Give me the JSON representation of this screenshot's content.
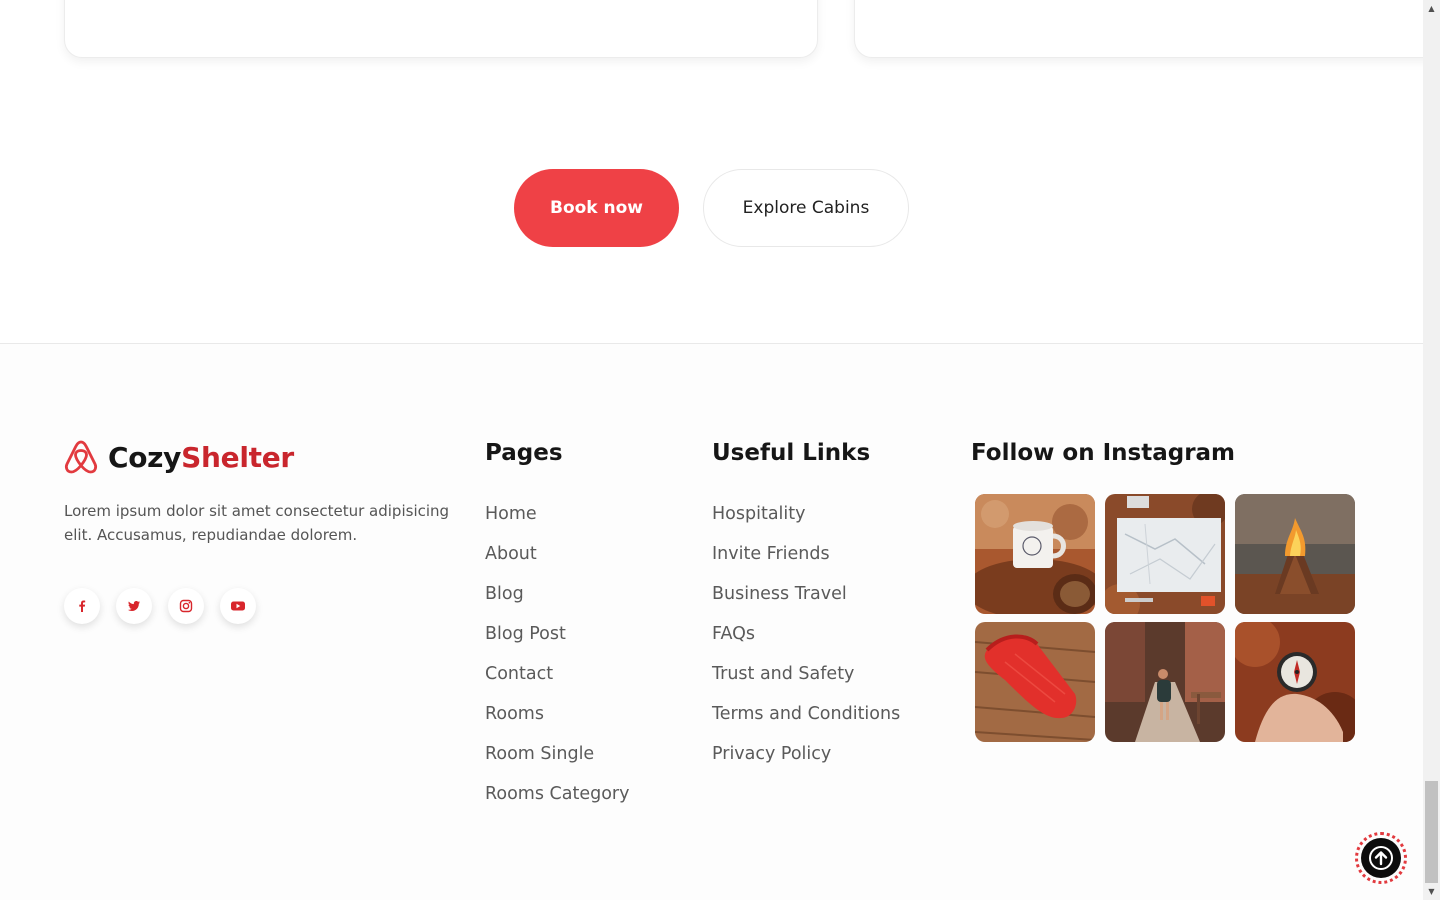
{
  "cta": {
    "book_label": "Book now",
    "explore_label": "Explore Cabins"
  },
  "brand": {
    "name_part1": "Cozy",
    "name_part2": "Shelter",
    "description": "Lorem ipsum dolor sit amet consectetur adipisicing elit. Accusamus, repudiandae dolorem.",
    "accent_color": "#c9262d",
    "socials": [
      {
        "icon": "facebook-icon"
      },
      {
        "icon": "twitter-icon"
      },
      {
        "icon": "instagram-icon"
      },
      {
        "icon": "youtube-icon"
      }
    ]
  },
  "pages": {
    "title": "Pages",
    "items": [
      "Home",
      "About",
      "Blog",
      "Blog Post",
      "Contact",
      "Rooms",
      "Room Single",
      "Rooms Category"
    ]
  },
  "useful_links": {
    "title": "Useful Links",
    "items": [
      "Hospitality",
      "Invite Friends",
      "Business Travel",
      "FAQs",
      "Trust and Safety",
      "Terms and Conditions",
      "Privacy Policy"
    ]
  },
  "instagram": {
    "title": "Follow on Instagram",
    "photos": [
      "camping mug on log",
      "map with gear",
      "campfire",
      "red sleeping bag on wood",
      "hiker on trail",
      "compass in hand"
    ]
  },
  "colors": {
    "primary": "#ef4146",
    "dark": "#161616"
  }
}
